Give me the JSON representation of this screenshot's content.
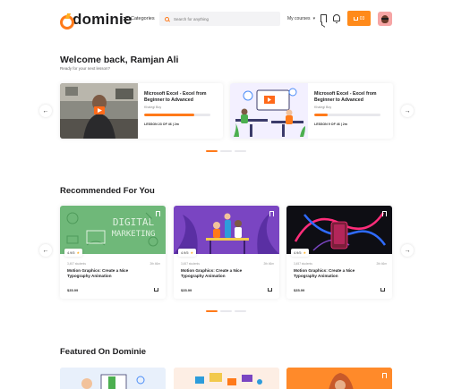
{
  "header": {
    "brand": "dominie",
    "categories_label": "Categories",
    "search_placeholder": "Search for anything",
    "my_courses_label": "My courses",
    "cart_count": "03"
  },
  "welcome": {
    "title": "Welcome back, Ramjan Ali",
    "subtitle": "Ready for your next lesson?"
  },
  "continue_courses": [
    {
      "title": "Microsoft Excel - Excel from Beginner to Advanced",
      "author": "Khalegi Boy",
      "lesson": "LESSON 23 OF 46 | 2m",
      "progress": 0.75
    },
    {
      "title": "Microsoft Excel - Excel from Beginner to Advanced",
      "author": "Khalegi Boy",
      "lesson": "LESSON 9 OF 46 | 2m",
      "progress": 0.2
    }
  ],
  "recommended_title": "Recommended For You",
  "recommended": [
    {
      "rating": "4.9/5",
      "students": "3,457 students",
      "duration": "2th 46m",
      "title": "Motion Graphics: Create a Nice Typography Animation",
      "price": "$35.99",
      "thumb_text_1": "DIGITAL",
      "thumb_text_2": "MARKETING"
    },
    {
      "rating": "4.9/5",
      "students": "3,457 students",
      "duration": "2th 46m",
      "title": "Motion Graphics: Create a Nice Typography Animation",
      "price": "$35.99"
    },
    {
      "rating": "4.9/5",
      "students": "3,457 students",
      "duration": "2th 46m",
      "title": "Motion Graphics: Create a Nice Typography Animation",
      "price": "$35.99"
    }
  ],
  "featured_title": "Featured On Dominie",
  "icons": {
    "arrow_left": "←",
    "arrow_right": "→",
    "chevron": "▾",
    "star": "★"
  },
  "colors": {
    "accent": "#ff7a1a",
    "rec1_bg": "#6fb879",
    "rec2_bg": "#7a45c2",
    "rec3_bg": "#0e0e14"
  }
}
